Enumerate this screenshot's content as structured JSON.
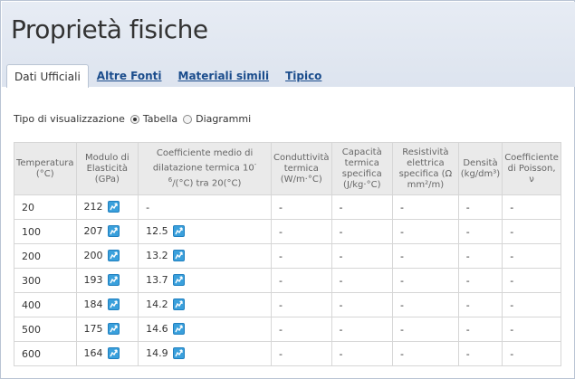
{
  "page": {
    "title": "Proprietà fisiche"
  },
  "tabs": [
    {
      "label": "Dati Ufficiali",
      "active": true
    },
    {
      "label": "Altre Fonti",
      "active": false
    },
    {
      "label": "Materiali simili",
      "active": false
    },
    {
      "label": "Tipico",
      "active": false
    }
  ],
  "visualization": {
    "label": "Tipo di visualizzazione",
    "options": [
      {
        "label": "Tabella",
        "selected": true
      },
      {
        "label": "Diagrammi",
        "selected": false
      }
    ]
  },
  "table": {
    "headers": [
      "Temperatura (°C)",
      "Modulo di Elasticità (GPa)",
      "Coefficiente medio di dilatazione termica 10",
      "Conduttività termica (W/m·°C)",
      "Capacità termica specifica (J/kg·°C)",
      "Resistività elettrica specifica (Ω mm²/m)",
      "Densità (kg/dm³)",
      "Coefficiente di Poisson, ν"
    ],
    "header_exp": "-6",
    "header_tail": "/(°C) tra 20(°C)",
    "rows": [
      [
        "20",
        "212",
        "-",
        "-",
        "-",
        "-",
        "-",
        "-"
      ],
      [
        "100",
        "207",
        "12.5",
        "-",
        "-",
        "-",
        "-",
        "-"
      ],
      [
        "200",
        "200",
        "13.2",
        "-",
        "-",
        "-",
        "-",
        "-"
      ],
      [
        "300",
        "193",
        "13.7",
        "-",
        "-",
        "-",
        "-",
        "-"
      ],
      [
        "400",
        "184",
        "14.2",
        "-",
        "-",
        "-",
        "-",
        "-"
      ],
      [
        "500",
        "175",
        "14.6",
        "-",
        "-",
        "-",
        "-",
        "-"
      ],
      [
        "600",
        "164",
        "14.9",
        "-",
        "-",
        "-",
        "-",
        "-"
      ]
    ]
  },
  "colors": {
    "accent": "#1a4c8c",
    "header_bg": "#dde4ef",
    "icon": "#3aa0dc"
  }
}
